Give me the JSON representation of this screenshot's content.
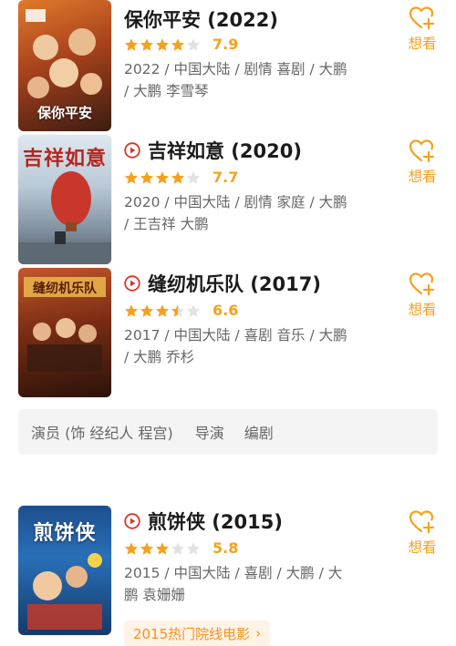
{
  "movies": [
    {
      "title": "保你平安 (2022)",
      "has_play": false,
      "rating": 7.9,
      "score": "7.9",
      "meta": "2022 / 中国大陆 / 剧情 喜剧 / 大鹏 / 大鹏 李雪琴",
      "poster_text": "保你平安",
      "want_label": "想看"
    },
    {
      "title": "吉祥如意 (2020)",
      "has_play": true,
      "rating": 7.7,
      "score": "7.7",
      "meta": "2020 / 中国大陆 / 剧情 家庭 / 大鹏 / 王吉祥 大鹏",
      "poster_text": "吉祥如意",
      "want_label": "想看"
    },
    {
      "title": "缝纫机乐队 (2017)",
      "has_play": true,
      "rating": 6.6,
      "score": "6.6",
      "meta": "2017 / 中国大陆 / 喜剧 音乐 / 大鹏 / 大鹏 乔杉",
      "poster_text": "缝纫机乐队",
      "want_label": "想看"
    },
    {
      "title": "煎饼侠 (2015)",
      "has_play": true,
      "rating": 5.8,
      "score": "5.8",
      "meta": "2015 / 中国大陆 / 喜剧 / 大鹏 / 大鹏 袁姗姗",
      "poster_text": "煎饼侠",
      "want_label": "想看"
    }
  ],
  "role_tabs": {
    "actor": "演员 (饰 经纪人 程宫)",
    "director": "导演",
    "writer": "编剧"
  },
  "chip": {
    "label": "2015热门院线电影",
    "icon": "chevron-right-icon"
  },
  "colors": {
    "accent": "#f5a11f",
    "play": "#d9352b",
    "meta": "#666666"
  }
}
